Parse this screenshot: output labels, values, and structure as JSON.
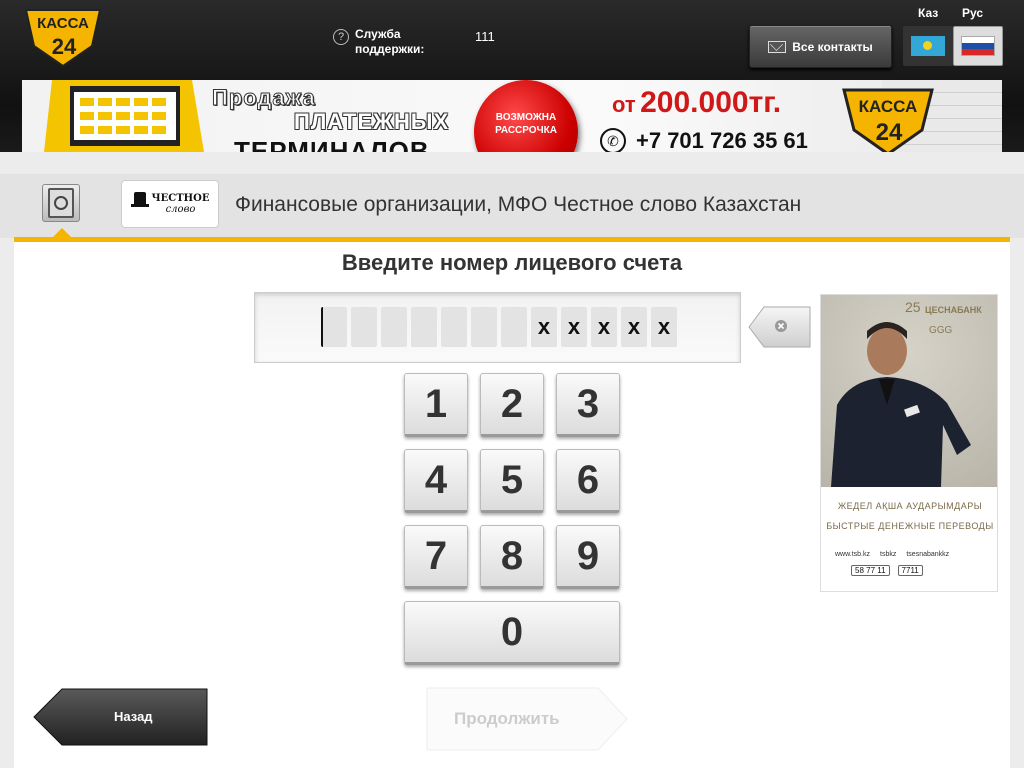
{
  "header": {
    "logo_text_top": "КАССА",
    "logo_text_bottom": "24",
    "support_label": "Служба поддержки:",
    "support_phone": "111",
    "contacts_button": "Все контакты",
    "lang_kz": "Каз",
    "lang_ru": "Рус"
  },
  "banner": {
    "line1": "Продажа",
    "line2": "ПЛАТЕЖНЫХ",
    "line3": "ТЕРМИНАЛОВ",
    "seal": "ВОЗМОЖНА РАССРОЧКА",
    "price_prefix": "от",
    "price": "200.000тг.",
    "phone": "+7 701 726 35 61",
    "logo_top": "КАССА",
    "logo_bottom": "24"
  },
  "provider": {
    "logo_line1": "ЧЕСТНОЕ",
    "logo_line2": "слово",
    "title": "Финансовые организации, МФО Честное слово Казахстан"
  },
  "form": {
    "prompt": "Введите номер лицевого счета",
    "slots": [
      "",
      "",
      "",
      "",
      "",
      "",
      "",
      "x",
      "x",
      "x",
      "x",
      "x"
    ]
  },
  "keypad": {
    "keys": [
      "1",
      "2",
      "3",
      "4",
      "5",
      "6",
      "7",
      "8",
      "9",
      "0"
    ]
  },
  "ad": {
    "anniversary": "25",
    "bank": "ЦЕСНАБАНК",
    "ggg": "GGG",
    "line_kz": "ЖЕДЕЛ АҚША АУДАРЫМДАРЫ",
    "line_ru": "БЫСТРЫЕ ДЕНЕЖНЫЕ ПЕРЕВОДЫ",
    "link1": "www.tsb.kz",
    "link2": "tsbkz",
    "link3": "tsesnabankkz",
    "phone1": "58 77 11",
    "phone2": "7711"
  },
  "nav": {
    "back": "Назад",
    "next": "Продолжить"
  },
  "colors": {
    "accent": "#f5b400",
    "banner_red": "#d01818"
  }
}
